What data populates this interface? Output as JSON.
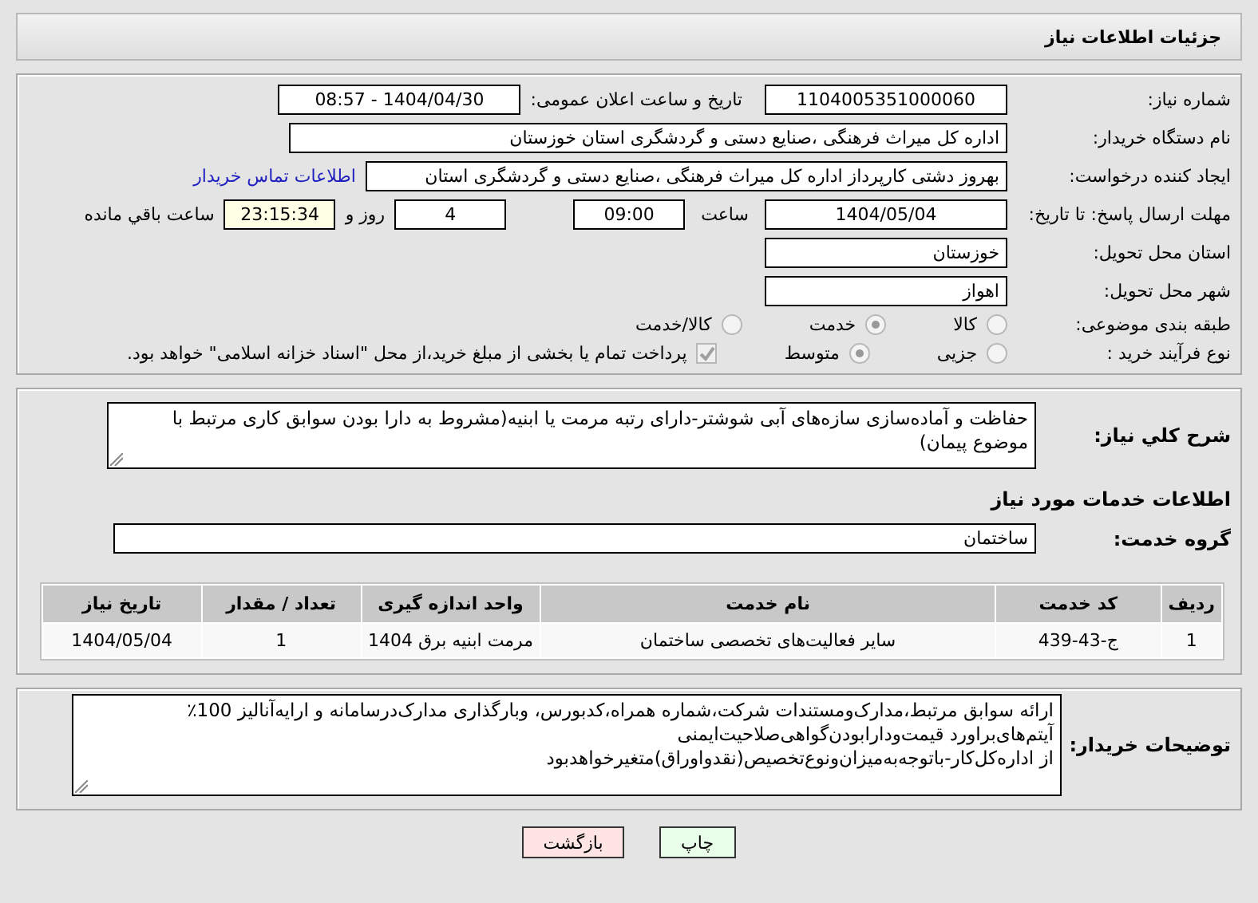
{
  "page_title": "جزئیات اطلاعات نیاز",
  "need_number": {
    "label": "شماره نیاز:",
    "value": "1104005351000060"
  },
  "announcement": {
    "label": "تاریخ و ساعت اعلان عمومی:",
    "value": "1404/04/30 - 08:57"
  },
  "buyer_org": {
    "label": "نام دستگاه خریدار:",
    "value": "اداره کل میراث فرهنگی ،صنایع دستی و گردشگری استان خوزستان"
  },
  "creator": {
    "label": "ایجاد کننده درخواست:",
    "value": "بهروز دشتی کارپرداز اداره کل میراث فرهنگی ،صنایع دستی و گردشگری استان",
    "link": "اطلاعات تماس خریدار"
  },
  "deadline": {
    "label": "مهلت ارسال پاسخ: تا تاریخ:",
    "date": "1404/05/04",
    "time_label": "ساعت",
    "time": "09:00",
    "days": "4",
    "days_label": "روز و",
    "remaining": "23:15:34",
    "remaining_label": "ساعت باقي مانده"
  },
  "province": {
    "label": "استان محل تحویل:",
    "value": "خوزستان"
  },
  "city": {
    "label": "شهر محل تحویل:",
    "value": "اهواز"
  },
  "subject_category": {
    "label": "طبقه بندی موضوعی:",
    "options": [
      {
        "label": "کالا",
        "selected": false
      },
      {
        "label": "خدمت",
        "selected": true
      },
      {
        "label": "کالا/خدمت",
        "selected": false
      }
    ]
  },
  "purchase_type": {
    "label": "نوع فرآیند خرید :",
    "options": [
      {
        "label": "جزیی",
        "selected": false
      },
      {
        "label": "متوسط",
        "selected": true
      }
    ],
    "payment": {
      "checked": true,
      "text": "پرداخت تمام یا بخشی از مبلغ خرید،از محل \"اسناد خزانه اسلامی\" خواهد بود."
    }
  },
  "description": {
    "label": "شرح کلي نیاز:",
    "value": "حفاظت و آماده‌سازی سازه‌های آبی شوشتر-دارای رتبه مرمت یا ابنیه(مشروط به دارا بودن سوابق کاری مرتبط با موضوع پیمان)"
  },
  "services_heading": "اطلاعات خدمات مورد نیاز",
  "service_group": {
    "label": "گروه خدمت:",
    "value": "ساختمان"
  },
  "table": {
    "columns": [
      "ردیف",
      "کد خدمت",
      "نام خدمت",
      "واحد اندازه گیری",
      "تعداد / مقدار",
      "تاریخ نیاز"
    ],
    "rows": [
      [
        "1",
        "ج-43-439",
        "سایر فعالیت‌های تخصصی ساختمان",
        "مرمت ابنیه برق 1404",
        "1",
        "1404/05/04"
      ]
    ]
  },
  "buyer_notes": {
    "label": "توضیحات خریدار:",
    "lines": [
      "ارائه سوابق مرتبط،مدارک‌ومستندات شرکت،شماره همراه،کدبورس، وبارگذاری مدارک‌درسامانه و ارایه‌آنالیز 100٪",
      "آیتم‌های‌براورد قیمت‌ودارابودن‌گواهی‌صلاحیت‌ایمنی",
      "از اداره‌کل‌کار-باتوجه‌به‌میزان‌ونوع‌تخصیص(نقدواوراق)متغیرخواهدبود"
    ]
  },
  "buttons": [
    {
      "label": "چاپ",
      "kind": "print"
    },
    {
      "label": "بازگشت",
      "kind": "back"
    }
  ]
}
